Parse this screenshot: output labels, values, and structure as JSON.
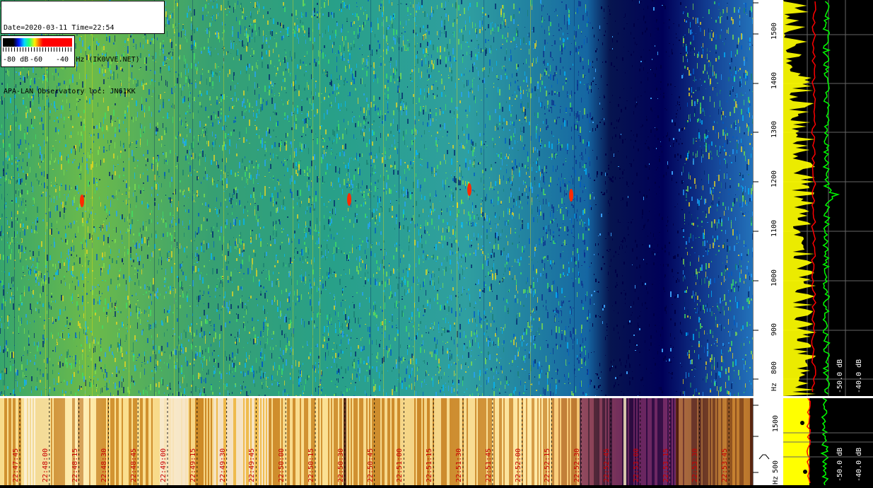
{
  "header": {
    "line1": "Date=2020-03-11 Time=22:54",
    "line2": "Freq= 760...1560 Hz (IK0VVE.NET)",
    "line3": "APA-LAN Observatory loc: JN61KK"
  },
  "legend": {
    "labels": [
      "-80 dB",
      "-60",
      "-40"
    ]
  },
  "freq_axis": {
    "ticks": [
      "1500",
      "1400",
      "1300",
      "1200",
      "1100",
      "1000",
      "900",
      "800"
    ],
    "unit": "Hz"
  },
  "bottom_axis": {
    "ticks": [
      "1500",
      "500"
    ],
    "unit": "Hz"
  },
  "spectrum_panel": {
    "label_a": "-50.0 dB",
    "label_b": "-40.0 dB"
  },
  "bottom_spectrum": {
    "label_a": "-50.0 dB",
    "label_b": "-40.0 dB"
  },
  "time_labels": [
    "22:47:45",
    "22:48:00",
    "22:48:15",
    "22:48:30",
    "22:48:45",
    "22:49:00",
    "22:49:15",
    "22:49:30",
    "22:49:45",
    "22:50:00",
    "22:50:15",
    "22:50:30",
    "22:50:45",
    "22:51:00",
    "22:51:15",
    "22:51:30",
    "22:51:45",
    "22:52:00",
    "22:52:15",
    "22:52:30",
    "22:52:45",
    "22:53:00",
    "22:53:15",
    "22:53:30",
    "22:53:45"
  ],
  "colors": {
    "spectrum_yellow": "#ffff00",
    "spectrum_green": "#00ff00",
    "spectrum_red": "#ff0000",
    "time_label_color": "#c80000"
  }
}
